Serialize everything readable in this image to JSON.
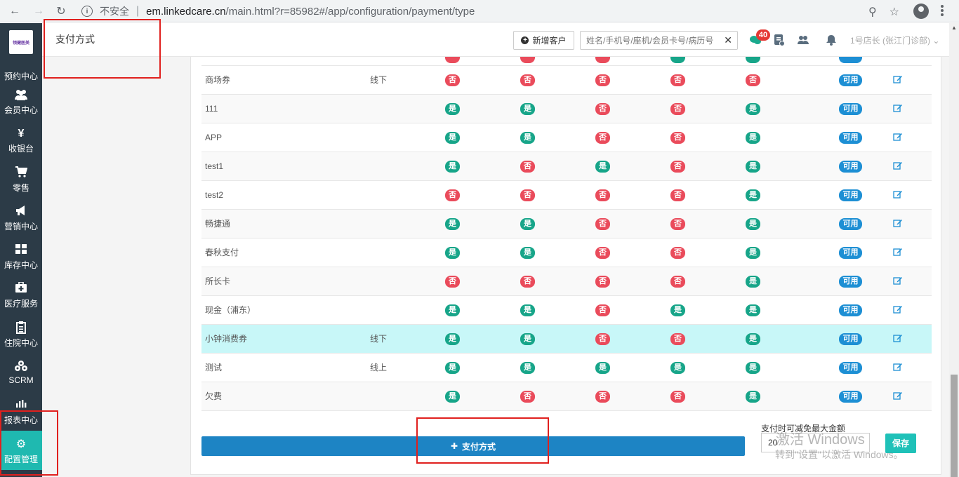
{
  "browser": {
    "security": "不安全",
    "url_host": "em.linkedcare.cn",
    "url_path": "/main.html?r=85982#/app/configuration/payment/type"
  },
  "sidebar": {
    "logo_text": "领健医美",
    "items": [
      {
        "label": "预约中心",
        "icon": "calendar-icon"
      },
      {
        "label": "会员中心",
        "icon": "users-icon"
      },
      {
        "label": "收银台",
        "icon": "yen-icon"
      },
      {
        "label": "零售",
        "icon": "cart-icon"
      },
      {
        "label": "营销中心",
        "icon": "megaphone-icon"
      },
      {
        "label": "库存中心",
        "icon": "grid-icon"
      },
      {
        "label": "医疗服务",
        "icon": "medkit-icon"
      },
      {
        "label": "住院中心",
        "icon": "clipboard-icon"
      },
      {
        "label": "SCRM",
        "icon": "cubes-icon"
      },
      {
        "label": "报表中心",
        "icon": "bar-chart-icon"
      },
      {
        "label": "配置管理",
        "icon": "gear-icon"
      }
    ]
  },
  "header": {
    "title": "支付方式",
    "new_customer": "新增客户",
    "search_placeholder": "姓名/手机号/座机/会员卡号/病历号",
    "message_count": "40",
    "user": "1号店长 (张江门诊部)"
  },
  "labels": {
    "yes": "是",
    "no": "否",
    "available": "可用"
  },
  "rows": [
    {
      "name": "商场券",
      "type": "线下",
      "flags": [
        false,
        false,
        false,
        false,
        false
      ]
    },
    {
      "name": "111",
      "type": "",
      "flags": [
        true,
        true,
        false,
        false,
        true
      ]
    },
    {
      "name": "APP",
      "type": "",
      "flags": [
        true,
        true,
        false,
        false,
        true
      ]
    },
    {
      "name": "test1",
      "type": "",
      "flags": [
        true,
        false,
        true,
        false,
        true
      ]
    },
    {
      "name": "test2",
      "type": "",
      "flags": [
        false,
        false,
        false,
        false,
        true
      ]
    },
    {
      "name": "畅捷通",
      "type": "",
      "flags": [
        true,
        true,
        false,
        false,
        true
      ]
    },
    {
      "name": "春秋支付",
      "type": "",
      "flags": [
        true,
        true,
        false,
        false,
        true
      ]
    },
    {
      "name": "所长卡",
      "type": "",
      "flags": [
        false,
        false,
        false,
        false,
        true
      ]
    },
    {
      "name": "现金（浦东）",
      "type": "",
      "flags": [
        true,
        true,
        false,
        true,
        true
      ]
    },
    {
      "name": "小钟消费券",
      "type": "线下",
      "flags": [
        true,
        true,
        false,
        false,
        true
      ]
    },
    {
      "name": "测试",
      "type": "线上",
      "flags": [
        true,
        true,
        true,
        true,
        true
      ]
    },
    {
      "name": "欠费",
      "type": "",
      "flags": [
        true,
        false,
        false,
        false,
        true
      ]
    }
  ],
  "footer": {
    "add_button": "支付方式",
    "max_label": "支付时可减免最大金额",
    "max_value": "20",
    "save": "保存"
  },
  "watermark": {
    "line1": "激活 Windows",
    "line2": "转到\"设置\"以激活 Windows。"
  },
  "colors": {
    "sidebar": "#2c3b47",
    "sidebar_active": "#1fb9b0",
    "yes": "#17a589",
    "no": "#ea4b5b",
    "available": "#1d8fd4",
    "primary": "#1d84c4",
    "row_highlight": "#c8f7f8"
  }
}
